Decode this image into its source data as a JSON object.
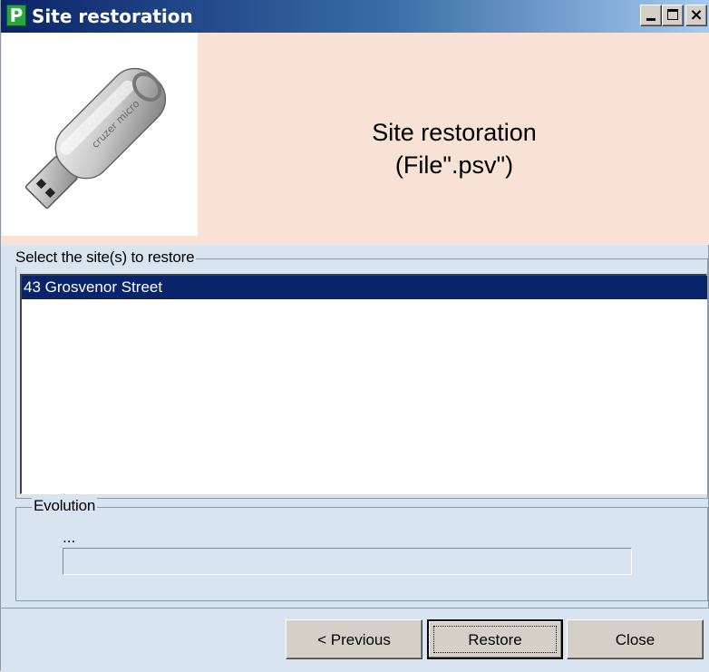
{
  "window": {
    "title": "Site restoration",
    "app_icon_letter": "P",
    "close_glyph": "×"
  },
  "banner": {
    "title_line1": "Site restoration",
    "title_line2": "(File\".psv\")",
    "image_icon": "usb-flash-drive"
  },
  "sites_group": {
    "label": "Select the site(s) to restore",
    "items": [
      {
        "label": "43 Grosvenor Street",
        "selected": true
      }
    ]
  },
  "evolution_group": {
    "label": "Evolution",
    "status_text": "...",
    "progress": 0
  },
  "buttons": {
    "previous": "< Previous",
    "restore": "Restore",
    "close": "Close"
  },
  "colors": {
    "title_gradient_start": "#0a246a",
    "title_gradient_end": "#a6caf0",
    "banner_bg": "#f8e2d6",
    "dialog_bg": "#d8e4ef",
    "selection_bg": "#0a246a"
  }
}
